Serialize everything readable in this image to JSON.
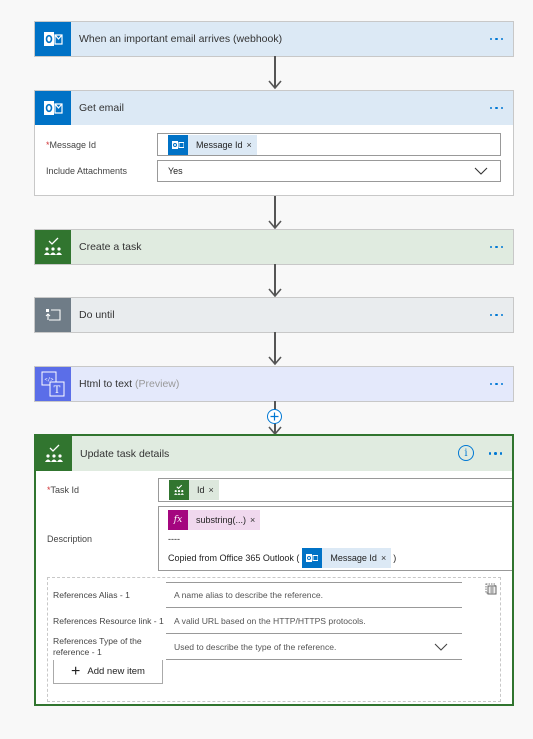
{
  "steps": [
    {
      "title": "When an important email arrives (webhook)",
      "icon": "outlook-icon"
    },
    {
      "title": "Get email",
      "icon": "outlook-icon",
      "fields": [
        {
          "label": "Message Id",
          "required": true,
          "token": "Message Id"
        },
        {
          "label": "Include Attachments",
          "required": false,
          "value": "Yes"
        }
      ]
    },
    {
      "title": "Create a task",
      "icon": "planner-icon"
    },
    {
      "title": "Do until",
      "icon": "do-until-icon"
    },
    {
      "title": "Html to text",
      "title_suffix": "(Preview)",
      "icon": "html-to-text-icon"
    },
    {
      "title": "Update task details",
      "icon": "planner-icon",
      "fields": {
        "task_id": {
          "label": "Task Id",
          "required": true,
          "token": "Id"
        },
        "description": {
          "label": "Description",
          "token1": "substring(...)",
          "separator": "----",
          "text_prefix": "Copied from Office 365 Outlook (",
          "token2": "Message Id",
          "text_suffix": ")"
        },
        "references": [
          {
            "label": "References Alias - 1",
            "placeholder": "A name alias to describe the reference."
          },
          {
            "label": "References Resource link - 1",
            "placeholder": "A valid URL based on the HTTP/HTTPS protocols."
          },
          {
            "label": "References Type of the reference - 1",
            "placeholder": "Used to describe the type of the reference."
          }
        ],
        "add_new_item": "Add new item"
      }
    }
  ],
  "required_mark": "*",
  "close_mark": "×",
  "info_mark": "i",
  "colors": {
    "outlook": "#0072c6",
    "planner": "#31752f",
    "do_until": "#6f7c87",
    "html_to_text": "#5b6ee8",
    "expression": "#a4067f",
    "accent": "#0078d4"
  }
}
